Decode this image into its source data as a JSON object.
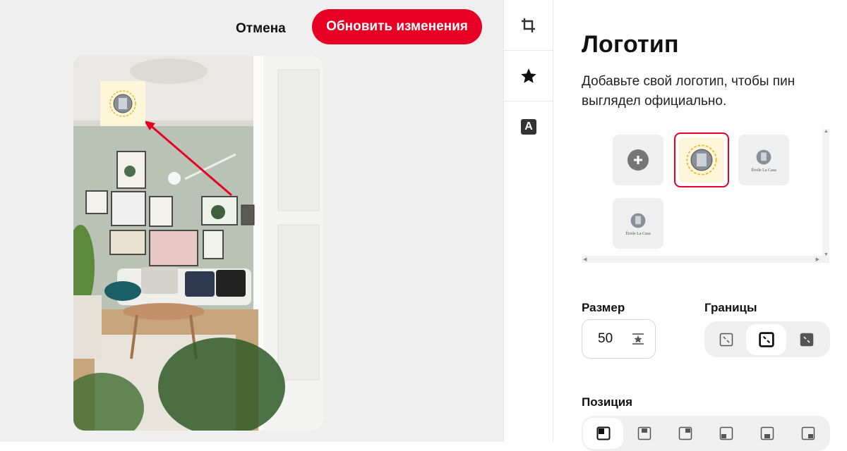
{
  "header": {
    "cancel_label": "Отмена",
    "update_label": "Обновить изменения"
  },
  "canvas": {
    "logo_overlay_icon": "logo-thumbnail-icon",
    "annotation_arrow_color": "#e60023"
  },
  "tools": [
    {
      "name": "crop-icon"
    },
    {
      "name": "star-icon"
    },
    {
      "name": "text-icon",
      "glyph": "A"
    }
  ],
  "panel": {
    "title": "Логотип",
    "description": "Добавьте свой логотип, чтобы пин выглядел официально.",
    "logo_tiles": [
      {
        "type": "add",
        "icon": "plus-icon"
      },
      {
        "type": "logo",
        "selected": true,
        "caption": ""
      },
      {
        "type": "logo",
        "selected": false,
        "caption": "Étoile La Casa"
      },
      {
        "type": "logo",
        "selected": false,
        "caption": "Étoile La Casa"
      }
    ],
    "size": {
      "label": "Размер",
      "value": "50"
    },
    "borders": {
      "label": "Границы",
      "options": [
        "border-none-icon",
        "border-selected-icon",
        "border-full-icon"
      ],
      "selected_index": 1
    },
    "position": {
      "label": "Позиция",
      "options": [
        "pos-top-left",
        "pos-top-center",
        "pos-top-right",
        "pos-bottom-left",
        "pos-bottom-center",
        "pos-bottom-right"
      ],
      "selected_index": 0
    }
  },
  "colors": {
    "accent": "#e60023",
    "canvas_bg": "#efefef",
    "tile_bg": "#efefef"
  }
}
